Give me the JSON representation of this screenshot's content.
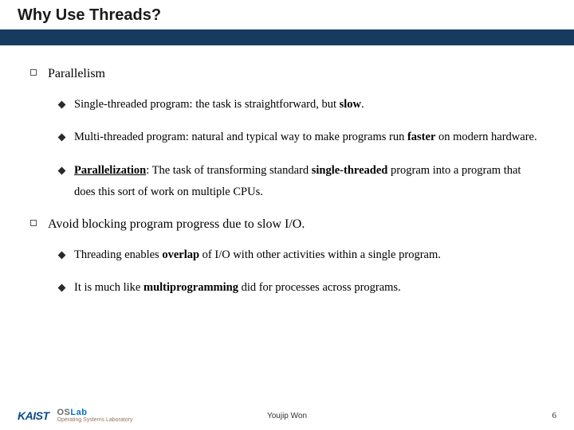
{
  "title": "Why Use Threads?",
  "sections": [
    {
      "heading": "Parallelism",
      "items": [
        {
          "pre": "Single-threaded program: the task is straightforward, but ",
          "bold1": "slow",
          "post1": "."
        },
        {
          "pre": "Multi-threaded program: natural and typical way to make programs run ",
          "bold1": "faster",
          "post1": " on modern hardware."
        },
        {
          "boldU": "Parallelization",
          "afterU": ": The task of transforming standard ",
          "bold1": "single-threaded",
          "post1": " program into a program that does this sort of work on multiple CPUs."
        }
      ]
    },
    {
      "heading": "Avoid blocking program progress due to slow I/O.",
      "items": [
        {
          "pre": "Threading enables ",
          "bold1": "overlap",
          "post1": " of I/O with other activities within a single program."
        },
        {
          "pre": "It is much like ",
          "bold1": "multiprogramming",
          "post1": " did for processes across programs."
        }
      ]
    }
  ],
  "footer": {
    "org": "KAIST",
    "lab_os": "OS",
    "lab_lab": "Lab",
    "lab_full": "Operating Systems Laboratory",
    "author": "Youjip Won",
    "page": "6"
  }
}
